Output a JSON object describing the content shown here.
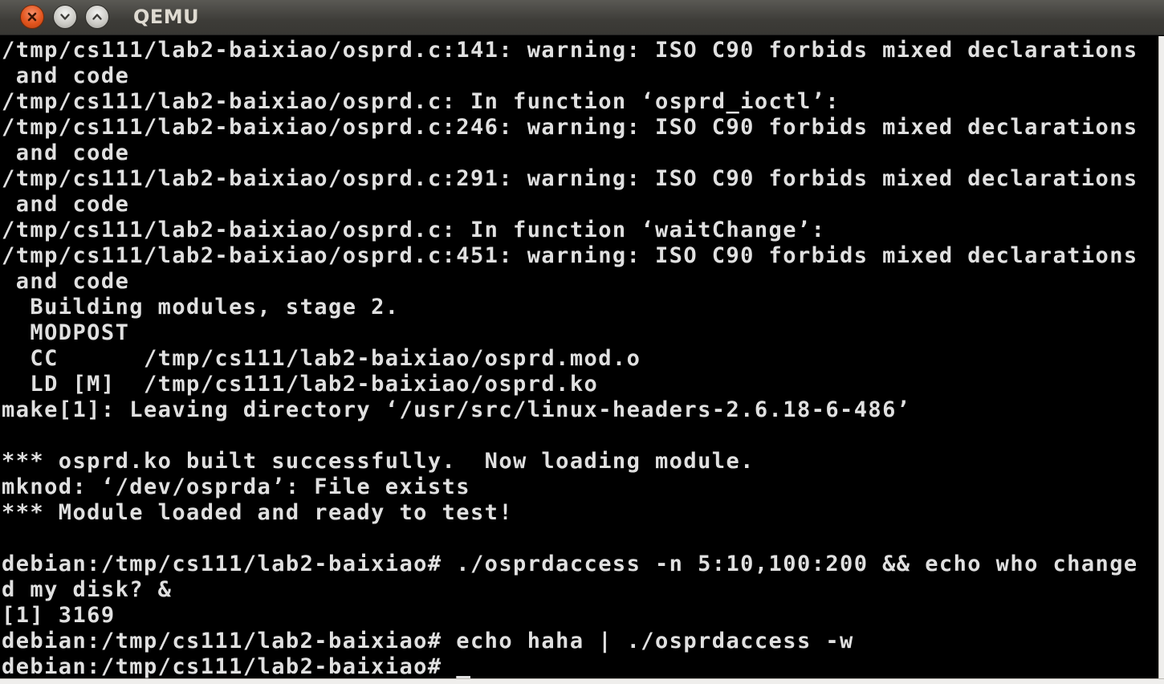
{
  "window": {
    "title": "QEMU",
    "buttons": {
      "close_icon": "close-icon",
      "minimize_icon": "chevron-down-icon",
      "maximize_icon": "chevron-up-icon"
    },
    "colors": {
      "close": "#e3551e",
      "titlebar": "#3d3c38",
      "title_text": "#dfdbd2",
      "terminal_bg": "#000000",
      "terminal_fg": "#e0e0e0"
    }
  },
  "terminal": {
    "lines": [
      "/tmp/cs111/lab2-baixiao/osprd.c:141: warning: ISO C90 forbids mixed declarations",
      " and code",
      "/tmp/cs111/lab2-baixiao/osprd.c: In function ‘osprd_ioctl’:",
      "/tmp/cs111/lab2-baixiao/osprd.c:246: warning: ISO C90 forbids mixed declarations",
      " and code",
      "/tmp/cs111/lab2-baixiao/osprd.c:291: warning: ISO C90 forbids mixed declarations",
      " and code",
      "/tmp/cs111/lab2-baixiao/osprd.c: In function ‘waitChange’:",
      "/tmp/cs111/lab2-baixiao/osprd.c:451: warning: ISO C90 forbids mixed declarations",
      " and code",
      "  Building modules, stage 2.",
      "  MODPOST",
      "  CC      /tmp/cs111/lab2-baixiao/osprd.mod.o",
      "  LD [M]  /tmp/cs111/lab2-baixiao/osprd.ko",
      "make[1]: Leaving directory ‘/usr/src/linux-headers-2.6.18-6-486’",
      "",
      "*** osprd.ko built successfully.  Now loading module.",
      "mknod: ‘/dev/osprda’: File exists",
      "*** Module loaded and ready to test!",
      "",
      "debian:/tmp/cs111/lab2-baixiao# ./osprdaccess -n 5:10,100:200 && echo who change",
      "d my disk? &",
      "[1] 3169",
      "debian:/tmp/cs111/lab2-baixiao# echo haha | ./osprdaccess -w"
    ],
    "prompt": "debian:/tmp/cs111/lab2-baixiao# ",
    "cursor": " "
  }
}
